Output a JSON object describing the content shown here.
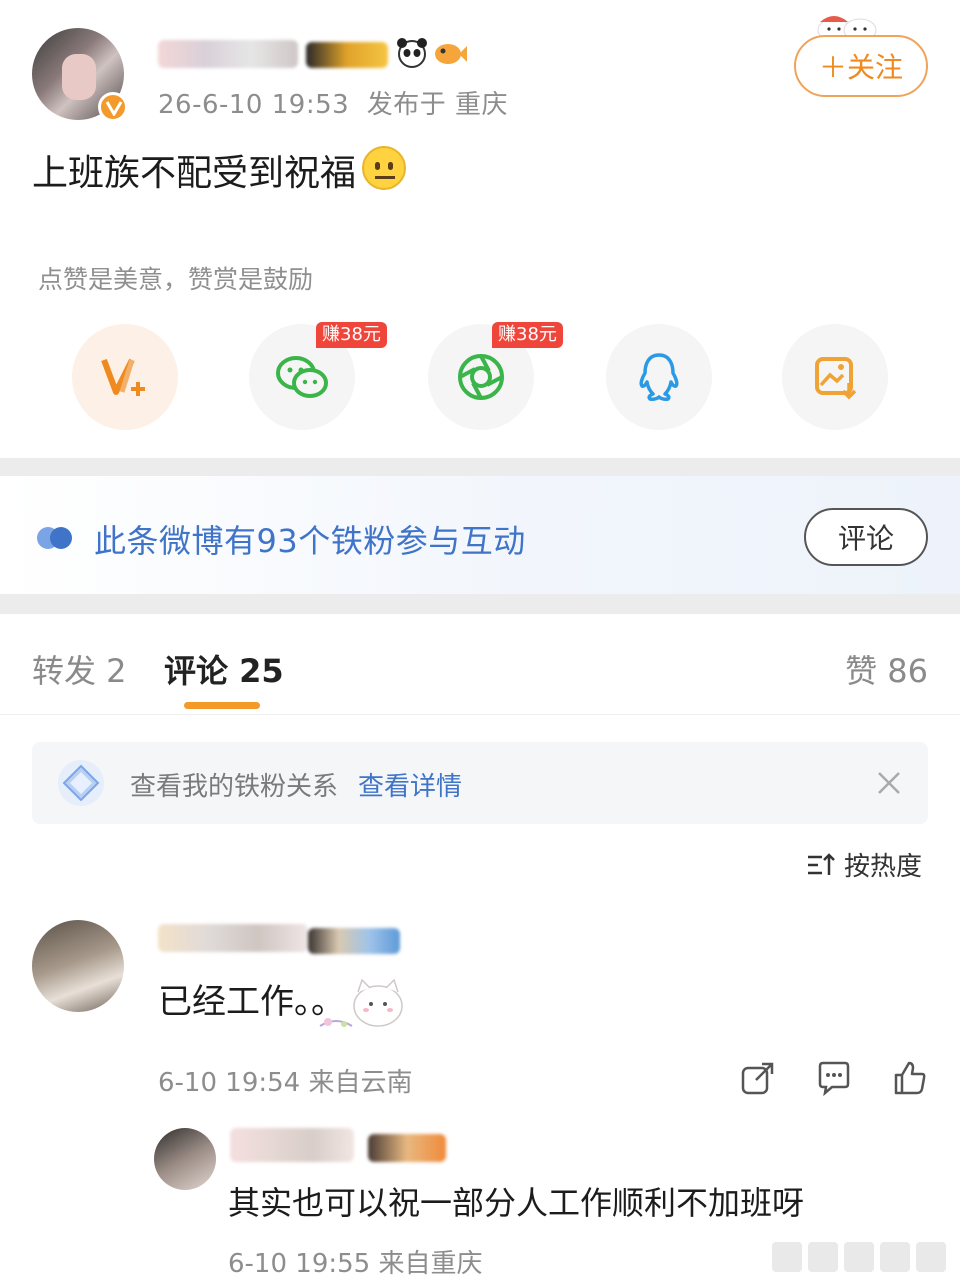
{
  "post": {
    "time": "26-6-10 19:53",
    "location": "发布于 重庆",
    "text": "上班族不配受到祝福",
    "follow_label": "＋关注"
  },
  "reward": {
    "hint": "点赞是美意，赞赏是鼓励",
    "share_items": [
      {
        "icon": "vip-plus-icon",
        "tag": ""
      },
      {
        "icon": "wechat-icon",
        "tag": "赚38元"
      },
      {
        "icon": "moments-icon",
        "tag": "赚38元"
      },
      {
        "icon": "qq-icon",
        "tag": ""
      },
      {
        "icon": "save-image-icon",
        "tag": ""
      }
    ]
  },
  "fans_banner": {
    "text": "此条微博有93个铁粉参与互动",
    "button": "评论"
  },
  "tabs": {
    "repost": "转发 2",
    "comment": "评论 25",
    "like": "赞 86"
  },
  "fan_relation": {
    "text": "查看我的铁粉关系",
    "link": "查看详情"
  },
  "sort_label": "按热度",
  "comments": [
    {
      "text": "已经工作。。",
      "meta": "6-10 19:54 来自云南",
      "reply": {
        "text": "其实也可以祝一部分人工作顺利不加班呀",
        "meta": "6-10 19:55 来自重庆"
      }
    }
  ],
  "colors": {
    "accent_orange": "#f08a1e",
    "link_blue": "#3f74c8",
    "earn_red": "#f0453a",
    "wechat_green": "#3bb54a",
    "qq_blue": "#2a9ae6"
  }
}
